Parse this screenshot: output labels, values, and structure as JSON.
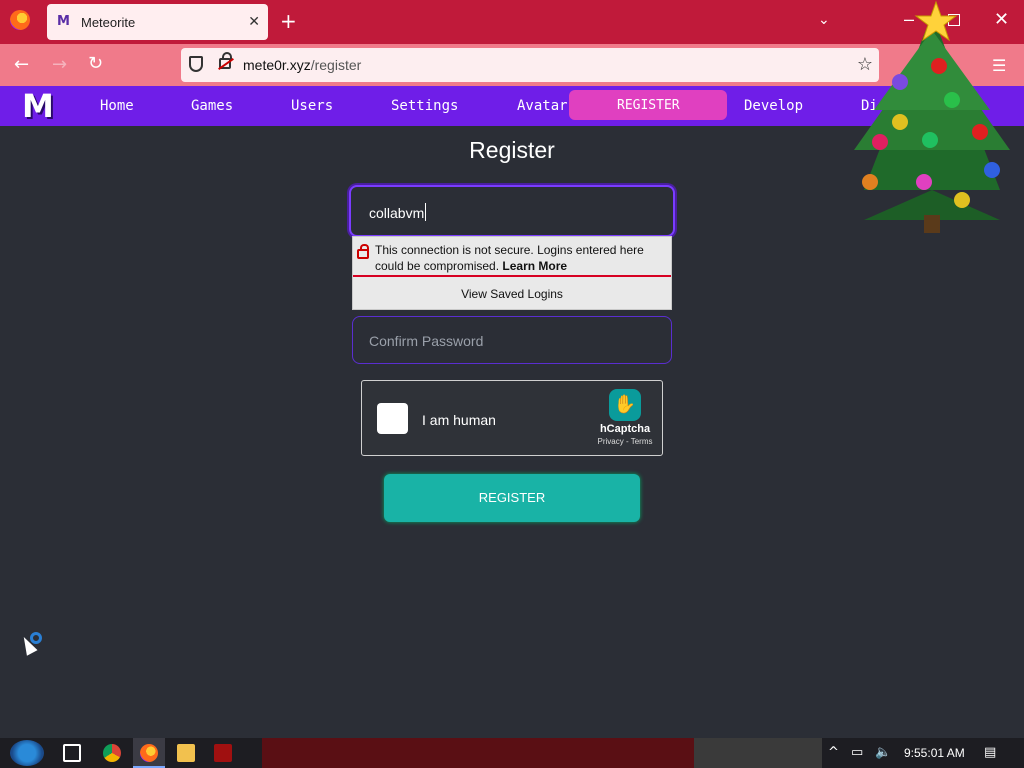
{
  "browser": {
    "tab_title": "Meteorite",
    "favicon_glyph": "M",
    "url_host": "mete0r.xyz",
    "url_path": "/register"
  },
  "site_nav": {
    "logo_text": "M",
    "items": [
      "Home",
      "Games",
      "Users",
      "Settings",
      "Avatar",
      "Develop",
      "Di"
    ],
    "pill_text": "REGISTER"
  },
  "page": {
    "title": "Register",
    "username_value": "collabvm",
    "autofill_popup": {
      "warning": "This connection is not secure. Logins entered here could be compromised.",
      "learn_more": "Learn More",
      "view_saved": "View Saved Logins"
    },
    "confirm_password_placeholder": "Confirm Password",
    "captcha": {
      "label": "I am human",
      "brand": "hCaptcha",
      "links": "Privacy - Terms"
    },
    "register_button": "REGISTER"
  },
  "taskbar": {
    "clock": "9:55:01 AM"
  },
  "colors": {
    "tabbar": "#c01a3a",
    "navbar": "#f07a8a",
    "site_nav": "#6f1ee8",
    "pill": "#e040c0",
    "page_bg": "#2b2e36",
    "register_button": "#19b3a6",
    "input_focus": "#7a3cff"
  }
}
